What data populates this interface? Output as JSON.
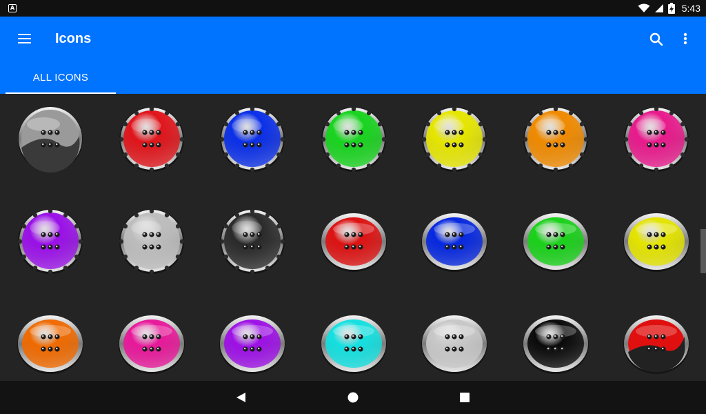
{
  "status_bar": {
    "left_icon": "A",
    "time": "5:43",
    "icons": [
      "wifi-icon",
      "signal-icon",
      "battery-charging-icon"
    ]
  },
  "app_bar": {
    "title": "Icons",
    "menu_icon": "hamburger-menu-icon",
    "search_icon": "search-icon",
    "more_icon": "more-vert-icon"
  },
  "tabs": [
    {
      "label": "ALL ICONS",
      "selected": true
    }
  ],
  "icons": [
    {
      "color": "#8a8a8a",
      "style": "split-gray"
    },
    {
      "color": "#e0151b",
      "style": "gear"
    },
    {
      "color": "#0a2fe8",
      "style": "gear"
    },
    {
      "color": "#18d41e",
      "style": "gear"
    },
    {
      "color": "#e6e600",
      "style": "gear"
    },
    {
      "color": "#f08a00",
      "style": "gear"
    },
    {
      "color": "#e81a8c",
      "style": "gear"
    },
    {
      "color": "#9a10e8",
      "style": "gear"
    },
    {
      "color": "#bdbdbd",
      "style": "gear"
    },
    {
      "color": "#2a2a2a",
      "style": "gear"
    },
    {
      "color": "#dd1212",
      "style": "bubble"
    },
    {
      "color": "#0628e0",
      "style": "bubble"
    },
    {
      "color": "#1ad11a",
      "style": "bubble"
    },
    {
      "color": "#e4e400",
      "style": "bubble"
    },
    {
      "color": "#f06a00",
      "style": "bubble"
    },
    {
      "color": "#e8189a",
      "style": "bubble"
    },
    {
      "color": "#9d10e6",
      "style": "bubble"
    },
    {
      "color": "#14e0e0",
      "style": "bubble"
    },
    {
      "color": "#c8c8c8",
      "style": "bubble"
    },
    {
      "color": "#0a0a0a",
      "style": "bubble"
    },
    {
      "color": "#e01010",
      "style": "split-red"
    }
  ],
  "nav_bar": {
    "back_icon": "back-triangle-icon",
    "home_icon": "home-circle-icon",
    "recent_icon": "recent-square-icon"
  }
}
